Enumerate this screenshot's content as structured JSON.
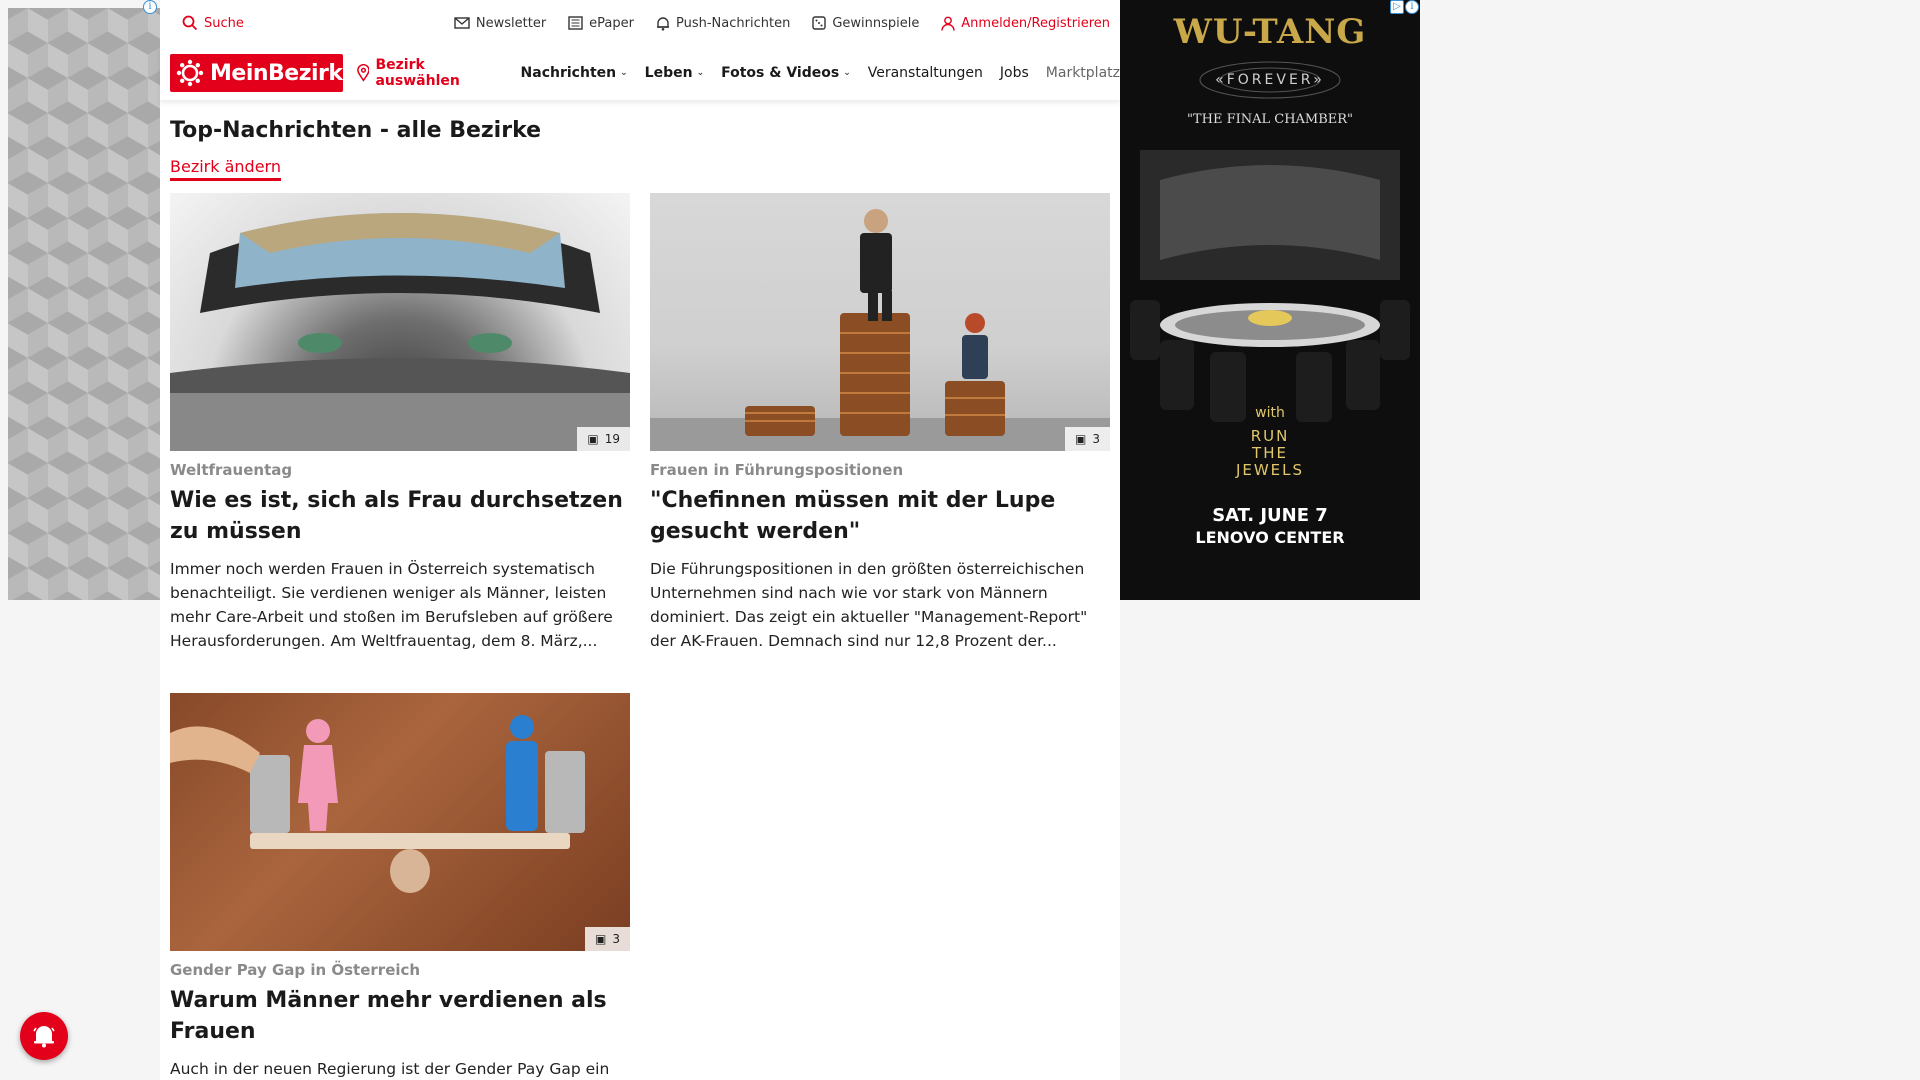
{
  "topbar": {
    "search": "Suche",
    "newsletter": "Newsletter",
    "epaper": "ePaper",
    "push": "Push-Nachrichten",
    "gewinnspiele": "Gewinnspiele",
    "login": "Anmelden/Registrieren"
  },
  "nav": {
    "logo": "MeinBezirk",
    "bezirk": "Bezirk auswählen",
    "items": [
      "Nachrichten",
      "Leben",
      "Fotos & Videos",
      "Veranstaltungen",
      "Jobs",
      "Marktplatz"
    ]
  },
  "page": {
    "title": "Top-Nachrichten - alle Bezirke",
    "change_bezirk": "Bezirk ändern"
  },
  "articles": [
    {
      "kicker": "Weltfrauentag",
      "headline": "Wie es ist, sich als Frau durchsetzen zu müssen",
      "teaser": "Immer noch werden Frauen in Österreich systematisch benachteiligt. Sie verdienen weniger als Männer, leisten mehr Care-Arbeit und stoßen im Berufsleben auf größere Herausforderungen. Am Weltfrauentag, dem 8. März,...",
      "photo_count": "19"
    },
    {
      "kicker": "Frauen in Führungspositionen",
      "headline": "\"Chefinnen müssen mit der Lupe gesucht werden\"",
      "teaser": "Die Führungspositionen in den größten österreichischen Unternehmen sind nach wie vor stark von Männern dominiert. Das zeigt ein aktueller \"Management-Report\" der AK-Frauen. Demnach sind nur 12,8 Prozent der...",
      "photo_count": "3"
    },
    {
      "kicker": "Gender Pay Gap in Österreich",
      "headline": "Warum Männer mehr verdienen als Frauen",
      "teaser": "Auch in der neuen Regierung ist der Gender Pay Gap ein",
      "photo_count": "3"
    }
  ],
  "ad_right": {
    "brand": "WU-TANG",
    "forever": "«FOREVER»",
    "final": "\"THE FINAL CHAMBER\"",
    "with": "with",
    "band_line1": "RUN",
    "band_line2": "THE",
    "band_line3": "JEWELS",
    "date": "SAT. JUNE 7",
    "venue": "LENOVO CENTER"
  },
  "colors": {
    "brand_red": "#e2001a"
  }
}
